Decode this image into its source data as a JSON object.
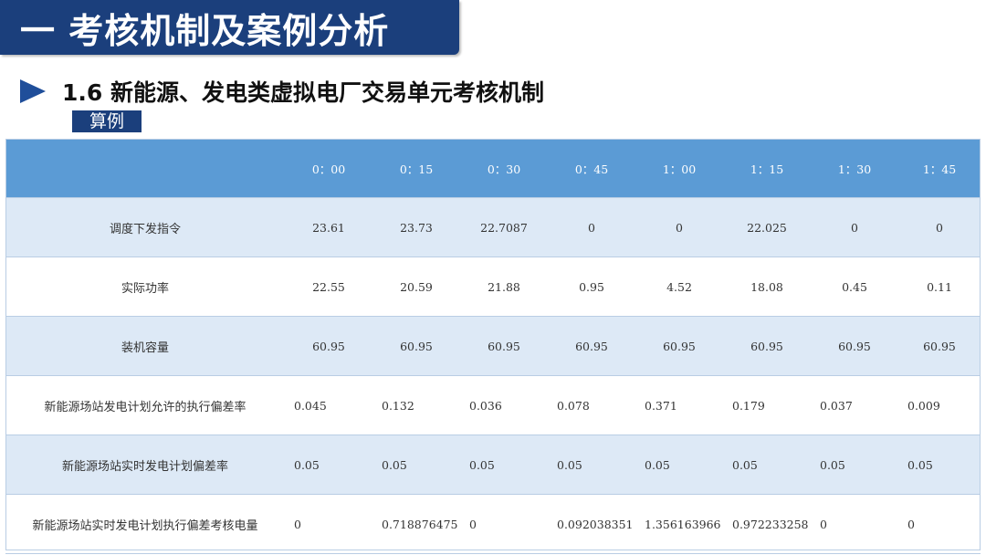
{
  "header": {
    "title": "一  考核机制及案例分析",
    "subtitle": "1.6 新能源、发电类虚拟电厂交易单元考核机制",
    "example_tag": "算例"
  },
  "table": {
    "columns": [
      "",
      "0：00",
      "0：15",
      "0：30",
      "0：45",
      "1：00",
      "1：15",
      "1：30",
      "1：45"
    ],
    "rows": [
      {
        "label": "调度下发指令",
        "align": "center",
        "values": [
          "23.61",
          "23.73",
          "22.7087",
          "0",
          "0",
          "22.025",
          "0",
          "0"
        ]
      },
      {
        "label": "实际功率",
        "align": "center",
        "values": [
          "22.55",
          "20.59",
          "21.88",
          "0.95",
          "4.52",
          "18.08",
          "0.45",
          "0.11"
        ]
      },
      {
        "label": "装机容量",
        "align": "center",
        "values": [
          "60.95",
          "60.95",
          "60.95",
          "60.95",
          "60.95",
          "60.95",
          "60.95",
          "60.95"
        ]
      },
      {
        "label": "新能源场站发电计划允许的执行偏差率",
        "align": "left",
        "values": [
          "0.045",
          "0.132",
          "0.036",
          "0.078",
          "0.371",
          "0.179",
          "0.037",
          "0.009"
        ]
      },
      {
        "label": "新能源场站实时发电计划偏差率",
        "align": "left",
        "values": [
          "0.05",
          "0.05",
          "0.05",
          "0.05",
          "0.05",
          "0.05",
          "0.05",
          "0.05"
        ]
      },
      {
        "label": "新能源场站实时发电计划执行偏差考核电量",
        "align": "left",
        "values": [
          "0",
          "0.718876475",
          "0",
          "0.092038351",
          "1.356163966",
          "0.972233258",
          "0",
          "0"
        ]
      }
    ]
  },
  "colors": {
    "title_bg": "#1b3f7c",
    "header_row_bg": "#5b9bd5",
    "band_row_bg": "#dde9f6",
    "triangle": "#1f4e9a"
  },
  "icons": {
    "bullet": "triangle-right-icon"
  }
}
